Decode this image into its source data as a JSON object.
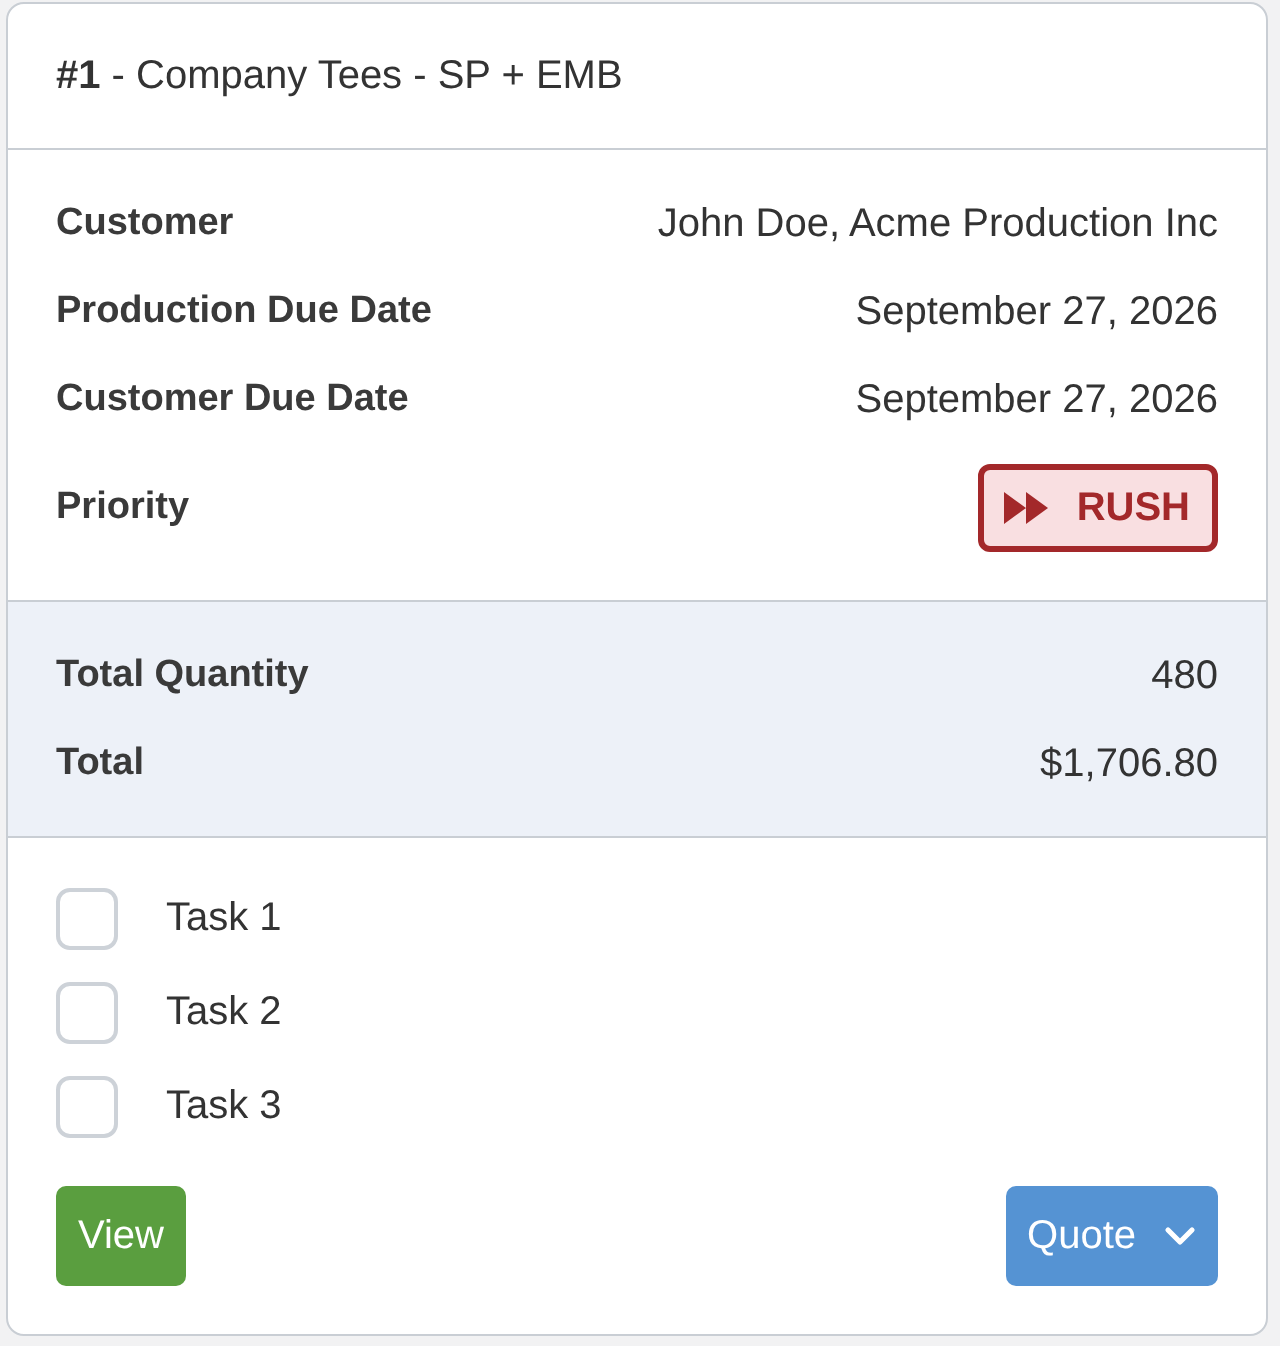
{
  "card": {
    "title": "**#1** - Company Tees - SP + EMB"
  },
  "details": [
    {
      "kind": "text",
      "label": "Customer",
      "value": "John Doe, Acme Production Inc"
    },
    {
      "kind": "text",
      "label": "Production Due Date",
      "value": "September 27, 2026"
    },
    {
      "kind": "text",
      "label": "Customer Due Date",
      "value": "September 27, 2026"
    },
    {
      "kind": "badge",
      "label": "Priority",
      "value": "RUSH"
    }
  ],
  "totals": [
    {
      "label": "Total Quantity",
      "value": "480"
    },
    {
      "label": "Total",
      "value": "$1,706.80"
    }
  ],
  "tasks": [
    {
      "label": "Task 1",
      "checked": false
    },
    {
      "label": "Task 2",
      "checked": false
    },
    {
      "label": "Task 3",
      "checked": false
    }
  ],
  "buttons": [
    {
      "kind": "view",
      "label": "View"
    },
    {
      "kind": "dropdown",
      "label": "Quote"
    }
  ]
}
